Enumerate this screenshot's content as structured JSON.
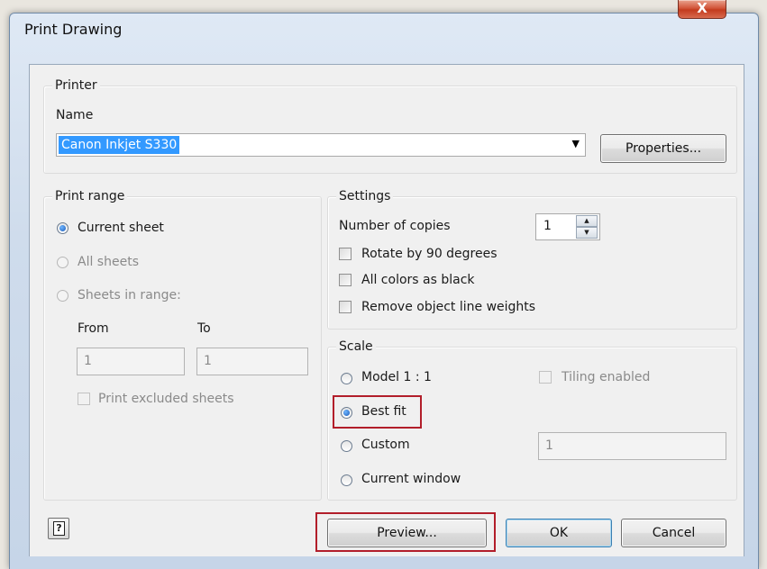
{
  "window": {
    "title": "Print Drawing",
    "close_label": "X"
  },
  "printer": {
    "group_label": "Printer",
    "name_label": "Name",
    "selected": "Canon Inkjet S330",
    "properties_button": "Properties..."
  },
  "print_range": {
    "group_label": "Print range",
    "current_sheet": "Current sheet",
    "all_sheets": "All sheets",
    "sheets_in_range": "Sheets in range:",
    "from_label": "From",
    "to_label": "To",
    "from_value": "1",
    "to_value": "1",
    "print_excluded": "Print excluded sheets",
    "selected_option": "Current sheet"
  },
  "settings": {
    "group_label": "Settings",
    "copies_label": "Number of copies",
    "copies_value": "1",
    "rotate_label": "Rotate by 90 degrees",
    "black_label": "All colors as black",
    "line_weights_label": "Remove object line weights"
  },
  "scale": {
    "group_label": "Scale",
    "model": "Model 1 : 1",
    "tiling": "Tiling enabled",
    "best_fit": "Best fit",
    "custom": "Custom",
    "custom_value": "1",
    "current_window": "Current window",
    "selected_option": "Best fit"
  },
  "buttons": {
    "help_glyph": "?",
    "preview": "Preview...",
    "ok": "OK",
    "cancel": "Cancel"
  },
  "colors": {
    "highlight": "#b21e2a",
    "selection": "#3399ff",
    "close": "#c33a1d"
  }
}
